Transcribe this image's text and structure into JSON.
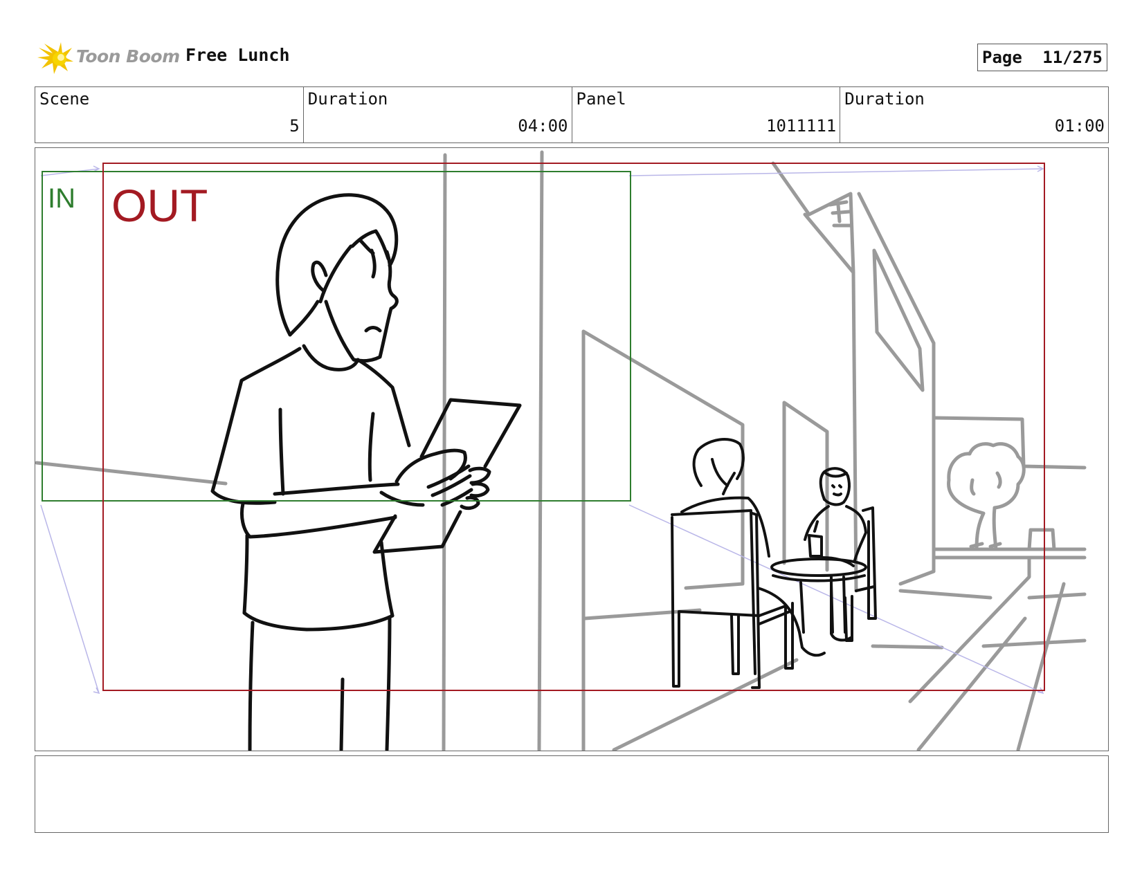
{
  "header": {
    "brand": "Toon Boom",
    "project_title": "Free Lunch",
    "page_label": "Page",
    "page_value": "11/275"
  },
  "info": {
    "scene_label": "Scene",
    "scene_value": "5",
    "scene_duration_label": "Duration",
    "scene_duration_value": "04:00",
    "panel_label": "Panel",
    "panel_value": "1011111",
    "panel_duration_label": "Duration",
    "panel_duration_value": "01:00"
  },
  "frame": {
    "in_label": "IN",
    "out_label": "OUT",
    "in_color": "#2e7d2e",
    "out_color": "#a31a22"
  },
  "caption": {
    "text": ""
  }
}
